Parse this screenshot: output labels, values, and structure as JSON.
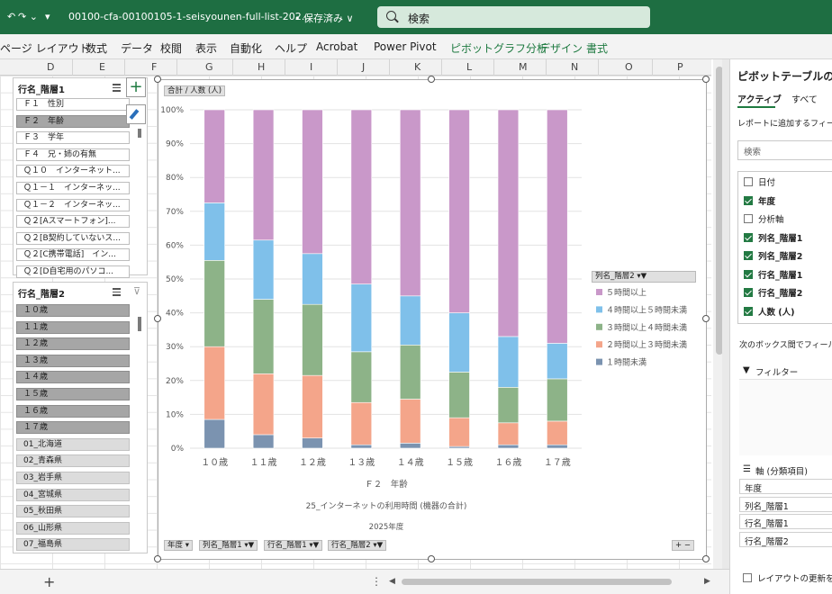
{
  "titlebar": {
    "filename": "00100-cfa-00100105-1-seisyounen-full-list-202...",
    "save_status": "• 保存済み ∨",
    "search_placeholder": "検索"
  },
  "ribbon": {
    "tabs": [
      "ページ レイアウト",
      "数式",
      "データ",
      "校閲",
      "表示",
      "自動化",
      "ヘルプ",
      "Acrobat",
      "Power Pivot"
    ],
    "context_tabs": [
      "ピボットグラフ分析",
      "デザイン",
      "書式"
    ]
  },
  "columns": [
    "D",
    "E",
    "F",
    "G",
    "H",
    "I",
    "J",
    "K",
    "L",
    "M",
    "N",
    "O",
    "P"
  ],
  "slicer1": {
    "header": "行名_階層1",
    "items": [
      {
        "label": "Ｆ１　性別",
        "state": "normal"
      },
      {
        "label": "Ｆ２　年齢",
        "state": "sel"
      },
      {
        "label": "Ｆ３　学年",
        "state": "normal"
      },
      {
        "label": "Ｆ４　兄・姉の有無",
        "state": "normal"
      },
      {
        "label": "Ｑ１０　インターネット...",
        "state": "normal"
      },
      {
        "label": "Ｑ１－１　インターネッ...",
        "state": "normal"
      },
      {
        "label": "Ｑ１－２　インターネッ...",
        "state": "normal"
      },
      {
        "label": "Ｑ２[Aスマートフォン]...",
        "state": "normal"
      },
      {
        "label": "Ｑ２[B契約していないス...",
        "state": "normal"
      },
      {
        "label": "Ｑ２[C携帯電話]　イン...",
        "state": "normal"
      },
      {
        "label": "Ｑ２[D自宅用のパソコ...",
        "state": "normal"
      }
    ]
  },
  "slicer2": {
    "header": "行名_階層2",
    "items": [
      {
        "label": "１０歳",
        "state": "sel"
      },
      {
        "label": "１１歳",
        "state": "sel"
      },
      {
        "label": "１２歳",
        "state": "sel"
      },
      {
        "label": "１３歳",
        "state": "sel"
      },
      {
        "label": "１４歳",
        "state": "sel"
      },
      {
        "label": "１５歳",
        "state": "sel"
      },
      {
        "label": "１６歳",
        "state": "sel"
      },
      {
        "label": "１７歳",
        "state": "sel"
      },
      {
        "label": "01_北海道",
        "state": "unsel"
      },
      {
        "label": "02_青森県",
        "state": "unsel"
      },
      {
        "label": "03_岩手県",
        "state": "unsel"
      },
      {
        "label": "04_宮城県",
        "state": "unsel"
      },
      {
        "label": "05_秋田県",
        "state": "unsel"
      },
      {
        "label": "06_山形県",
        "state": "unsel"
      },
      {
        "label": "07_福島県",
        "state": "unsel"
      }
    ]
  },
  "chart_data": {
    "type": "bar",
    "stacked": "percent",
    "value_button": "合計 / 人数 (人)",
    "categories": [
      "１０歳",
      "１１歳",
      "１２歳",
      "１３歳",
      "１４歳",
      "１５歳",
      "１６歳",
      "１７歳"
    ],
    "xlabel": "Ｆ２　年齢",
    "footnote1": "25_インターネットの利用時間 (機器の合計)",
    "footnote2": "2025年度",
    "yticks": [
      "0%",
      "10%",
      "20%",
      "30%",
      "40%",
      "50%",
      "60%",
      "70%",
      "80%",
      "90%",
      "100%"
    ],
    "ylim": [
      0,
      100
    ],
    "legend_title": "列名_階層2",
    "series": [
      {
        "name": "１時間未満",
        "color": "#7b93b0",
        "values": [
          8.5,
          4,
          3,
          1,
          1.5,
          0.5,
          1,
          1
        ]
      },
      {
        "name": "２時間以上３時間未満",
        "color": "#f4a58a",
        "values": [
          21.5,
          18,
          18.5,
          12.5,
          13,
          8.5,
          6.5,
          7
        ]
      },
      {
        "name": "３時間以上４時間未満",
        "color": "#8db388",
        "values": [
          25.5,
          22,
          21,
          15,
          16,
          13.5,
          10.5,
          12.5
        ]
      },
      {
        "name": "４時間以上５時間未満",
        "color": "#7fc0ea",
        "values": [
          17,
          17.5,
          15,
          20,
          14.5,
          17.5,
          15,
          10.5
        ]
      },
      {
        "name": "５時間以上",
        "color": "#c998c9",
        "values": [
          27.5,
          38.5,
          42.5,
          51.5,
          55,
          60,
          67,
          69
        ]
      }
    ],
    "legend_order": [
      "５時間以上",
      "４時間以上５時間未満",
      "３時間以上４時間未満",
      "２時間以上３時間未満",
      "１時間未満"
    ]
  },
  "field_buttons": [
    "年度",
    "列名_階層1",
    "行名_階層1",
    "行名_階層2"
  ],
  "pane": {
    "title": "ピボットテーブルのフィ",
    "tab_active": "アクティブ",
    "tab_all": "すべて",
    "hint": "レポートに追加するフィールド",
    "search": "検索",
    "fields": [
      {
        "label": "日付",
        "on": false,
        "bold": false
      },
      {
        "label": "年度",
        "on": true,
        "bold": true
      },
      {
        "label": "分析軸",
        "on": false,
        "bold": false
      },
      {
        "label": "列名_階層1",
        "on": true,
        "bold": true
      },
      {
        "label": "列名_階層2",
        "on": true,
        "bold": true
      },
      {
        "label": "行名_階層1",
        "on": true,
        "bold": true
      },
      {
        "label": "行名_階層2",
        "on": true,
        "bold": true
      },
      {
        "label": "人数 (人)",
        "on": true,
        "bold": true
      }
    ],
    "drag_hint": "次のボックス間でフィールドを",
    "filter_label": "フィルター",
    "axis_label": "軸 (分類項目)",
    "axis_items": [
      "年度",
      "列名_階層1",
      "行名_階層1",
      "行名_階層2"
    ],
    "defer_label": "レイアウトの更新を保"
  }
}
